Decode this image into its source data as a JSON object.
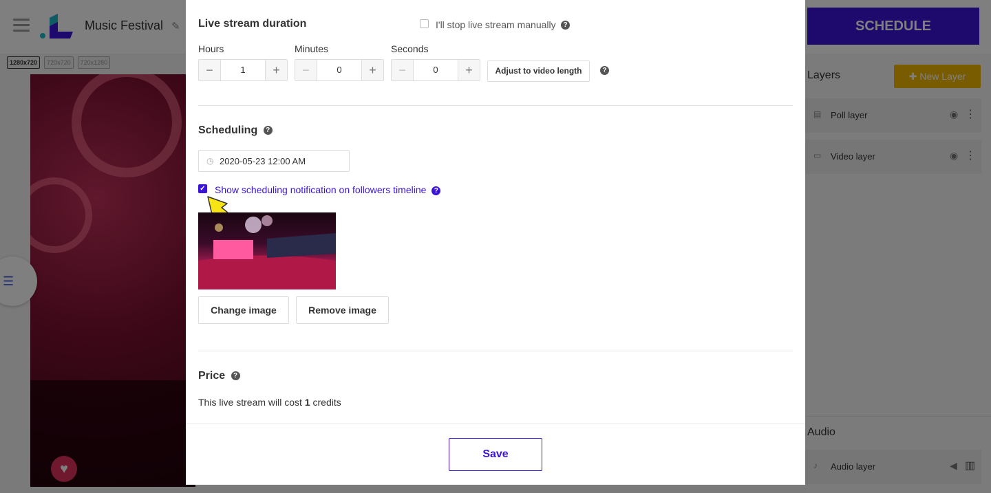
{
  "app": {
    "project_title": "Music Festival",
    "resolutions": [
      "1280x720",
      "720x720",
      "720x1280"
    ],
    "schedule_label": "SCHEDULE",
    "layers_title": "Layers",
    "new_layer_label": "New Layer",
    "layers": [
      {
        "label": "Poll layer",
        "icon": "poll-icon"
      },
      {
        "label": "Video layer",
        "icon": "video-icon"
      }
    ],
    "audio_title": "Audio",
    "audio_layer_label": "Audio layer",
    "colors": {
      "brand": "#3c14d9",
      "accent": "#f5b800",
      "heart": "#e0305a"
    }
  },
  "modal": {
    "duration": {
      "title": "Live stream duration",
      "manual_stop_label": "I'll stop live stream manually",
      "manual_stop_checked": false,
      "hours_label": "Hours",
      "hours_value": "1",
      "minutes_label": "Minutes",
      "minutes_value": "0",
      "seconds_label": "Seconds",
      "seconds_value": "0",
      "adjust_label": "Adjust to video length"
    },
    "scheduling": {
      "title": "Scheduling",
      "datetime_value": "2020-05-23 12:00 AM",
      "notify_label": "Show scheduling notification on followers timeline",
      "notify_checked": true,
      "change_image_label": "Change image",
      "remove_image_label": "Remove image"
    },
    "price": {
      "title": "Price",
      "cost_prefix": "This live stream will cost ",
      "cost_amount": "1",
      "cost_suffix": " credits"
    },
    "save_label": "Save"
  }
}
